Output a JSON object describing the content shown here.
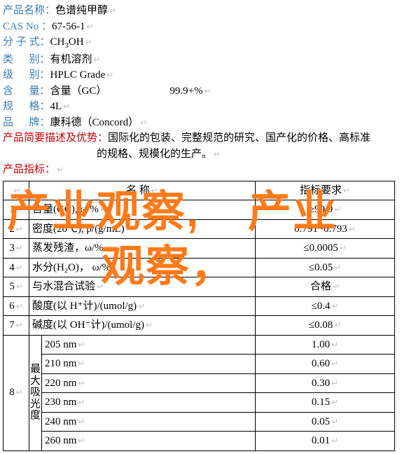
{
  "fields": {
    "name_lbl": "产品名称：",
    "name_val": "色谱纯甲醇",
    "cas_lbl": "CAS No ：",
    "cas_val": "67-56-1",
    "formula_lbl": "分 子 式：",
    "formula_main": "CH",
    "formula_sub1": "3",
    "formula_tail": "OH",
    "category_lbl": "类      别：",
    "category_val": "有机溶剂",
    "grade_lbl": "级      别：",
    "grade_val": "HPLC Grade",
    "content_lbl": "含      量：",
    "content_val": "含量（GC）",
    "content_pct": "99.9+%",
    "spec_lbl": "规      格：",
    "spec_val": "4L",
    "brand_lbl": "品      牌：",
    "brand_val": "康科德（Concord）",
    "desc_lbl": "产品简要描述及优势：",
    "desc_val1": "国际化的包装、完整规范的研究、国产化的价格、高标准",
    "desc_val2": "的规格、规模化的生产。",
    "indicator_lbl": "产品指标："
  },
  "table": {
    "head_name": "名     称",
    "head_req": "指标要求",
    "rows": [
      {
        "n": "1",
        "name": "含量(GC), ω/%",
        "req": "≥99.9"
      },
      {
        "n": "2",
        "name": "密度(20℃), ρ/(g/mL)",
        "req": "0.791~0.793"
      },
      {
        "n": "3",
        "name": "蒸发残渣，ω/%",
        "req": "≤0.0005"
      },
      {
        "n": "4",
        "name": "水分(H₂O)， ω/%",
        "req": "≤0.05"
      },
      {
        "n": "5",
        "name": "与水混合试验",
        "req": "合格"
      },
      {
        "n": "6",
        "name": "酸度(以 H⁺计)/(umol/g)",
        "req": "≤0.4"
      },
      {
        "n": "7",
        "name": "碱度(以 OH⁻计)/(umol/g)",
        "req": "≤0.08"
      }
    ],
    "abs_group": {
      "n": "8",
      "label": "最大吸光度",
      "items": [
        {
          "nm": "205 nm",
          "v": "1.00"
        },
        {
          "nm": "210 nm",
          "v": "0.60"
        },
        {
          "nm": "220 nm",
          "v": "0.30"
        },
        {
          "nm": "230 nm",
          "v": "0.15"
        },
        {
          "nm": "240 nm",
          "v": "0.05"
        },
        {
          "nm": "260 nm",
          "v": "0.01"
        }
      ]
    }
  },
  "watermark": {
    "t1": "产业观察,",
    "t2": "产业",
    "t3": "观察，"
  }
}
